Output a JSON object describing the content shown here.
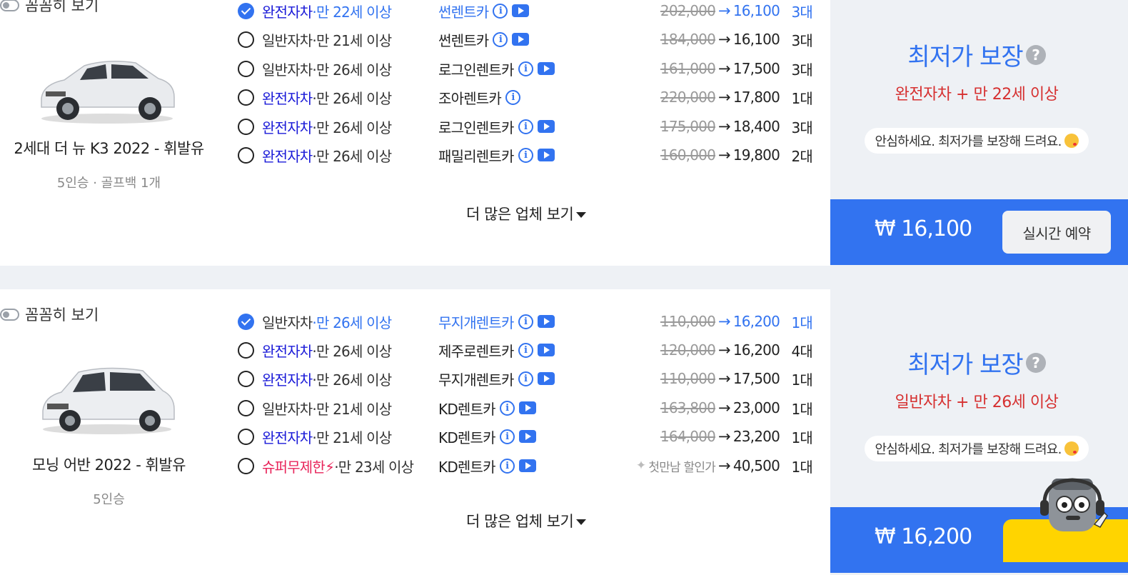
{
  "cards": [
    {
      "toggle_label": "꼼꼼히 보기",
      "car_name": "2세대 더 뉴 K3 2022 - 휘발유",
      "car_meta": "5인승 · 골프백 1개",
      "more_label": "더 많은 업체 보기",
      "guarantee_title": "최저가 보장",
      "guarantee_condition": "완전자차 + 만 22세 이상",
      "assure_text": "안심하세요. 최저가를 보장해 드려요.",
      "total_price": "₩ 16,100",
      "reserve_label": "실시간 예약",
      "offers": [
        {
          "selected": true,
          "plan": "완전자차",
          "plan_type": "blue",
          "age": "·만 22세 이상",
          "vendor": "썬렌트카",
          "yt": true,
          "orig": "202,000",
          "final": "16,100",
          "count": "3대"
        },
        {
          "selected": false,
          "plan": "일반자차",
          "plan_type": "plain",
          "age": "·만 21세 이상",
          "vendor": "썬렌트카",
          "yt": true,
          "orig": "184,000",
          "final": "16,100",
          "count": "3대"
        },
        {
          "selected": false,
          "plan": "일반자차",
          "plan_type": "plain",
          "age": "·만 26세 이상",
          "vendor": "로그인렌트카",
          "yt": true,
          "orig": "161,000",
          "final": "17,500",
          "count": "3대"
        },
        {
          "selected": false,
          "plan": "완전자차",
          "plan_type": "blue",
          "age": "·만 26세 이상",
          "vendor": "조아렌트카",
          "yt": false,
          "orig": "220,000",
          "final": "17,800",
          "count": "1대"
        },
        {
          "selected": false,
          "plan": "완전자차",
          "plan_type": "blue",
          "age": "·만 26세 이상",
          "vendor": "로그인렌트카",
          "yt": true,
          "orig": "175,000",
          "final": "18,400",
          "count": "3대"
        },
        {
          "selected": false,
          "plan": "완전자차",
          "plan_type": "blue",
          "age": "·만 26세 이상",
          "vendor": "패밀리렌트카",
          "yt": true,
          "orig": "160,000",
          "final": "19,800",
          "count": "2대"
        }
      ]
    },
    {
      "toggle_label": "꼼꼼히 보기",
      "car_name": "모닝 어반 2022 - 휘발유",
      "car_meta": "5인승",
      "more_label": "더 많은 업체 보기",
      "guarantee_title": "최저가 보장",
      "guarantee_condition": "일반자차 + 만 26세 이상",
      "assure_text": "안심하세요. 최저가를 보장해 드려요.",
      "total_price": "₩ 16,200",
      "reserve_label": "",
      "offers": [
        {
          "selected": true,
          "plan": "일반자차",
          "plan_type": "plain",
          "age": "·만 26세 이상",
          "vendor": "무지개렌트카",
          "yt": true,
          "orig": "110,000",
          "final": "16,200",
          "count": "1대"
        },
        {
          "selected": false,
          "plan": "완전자차",
          "plan_type": "blue",
          "age": "·만 26세 이상",
          "vendor": "제주로렌트카",
          "yt": true,
          "orig": "120,000",
          "final": "16,200",
          "count": "4대"
        },
        {
          "selected": false,
          "plan": "완전자차",
          "plan_type": "blue",
          "age": "·만 26세 이상",
          "vendor": "무지개렌트카",
          "yt": true,
          "orig": "110,000",
          "final": "17,500",
          "count": "1대"
        },
        {
          "selected": false,
          "plan": "일반자차",
          "plan_type": "plain",
          "age": "·만 21세 이상",
          "vendor": "KD렌트카",
          "yt": true,
          "orig": "163,800",
          "final": "23,000",
          "count": "1대"
        },
        {
          "selected": false,
          "plan": "완전자차",
          "plan_type": "blue",
          "age": "·만 21세 이상",
          "vendor": "KD렌트카",
          "yt": true,
          "orig": "164,000",
          "final": "23,200",
          "count": "1대"
        },
        {
          "selected": false,
          "plan": "슈퍼무제한",
          "plan_type": "red",
          "bolt": true,
          "age": "·만 23세 이상",
          "vendor": "KD렌트카",
          "yt": true,
          "orig": "",
          "discount_label": "첫만남 할인가",
          "final": "40,500",
          "count": "1대"
        }
      ]
    }
  ],
  "colors": {
    "accent": "#3273f0",
    "full_coverage": "#1a1ad8",
    "super": "#e8245a",
    "condition": "#d63030"
  }
}
